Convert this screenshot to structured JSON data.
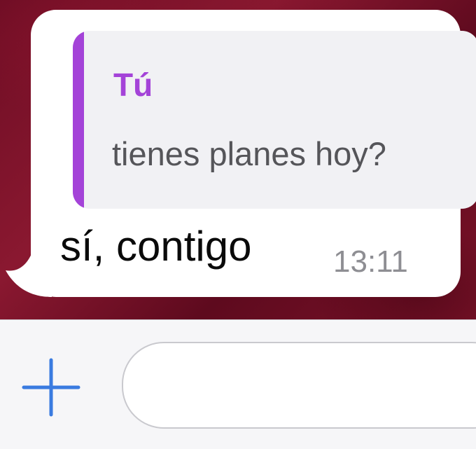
{
  "chat": {
    "message": {
      "quoted_author": "Tú",
      "quoted_text": "tienes planes hoy?",
      "text": "sí, contigo",
      "time": "13:11"
    }
  },
  "composer": {
    "add_icon": "plus-icon",
    "input_value": "",
    "input_placeholder": ""
  },
  "colors": {
    "quote_accent": "#a443d8",
    "add_icon": "#3a7be0",
    "chat_background": "#7a1228"
  }
}
